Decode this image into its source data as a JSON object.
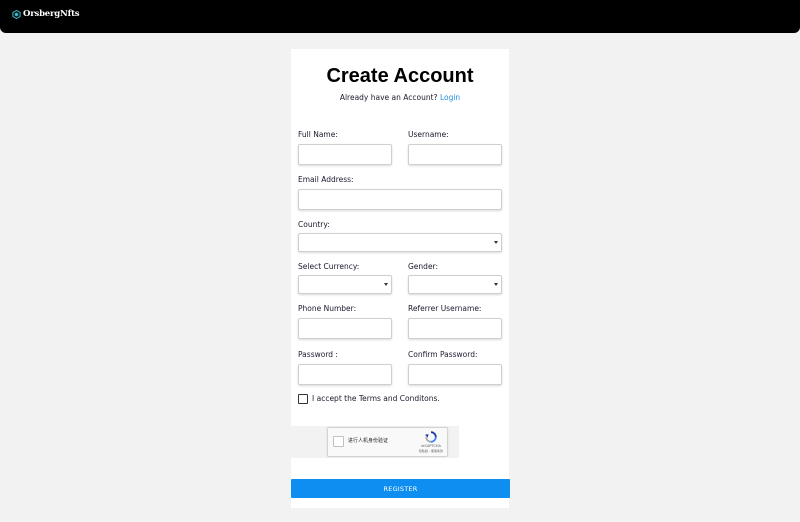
{
  "header": {
    "brand": "OrsbergNfts",
    "brand_icon": "hexagon-logo-icon",
    "accent_color": "#3ab7c9"
  },
  "form": {
    "title": "Create Account",
    "subtitle": "Already have an Account?",
    "login_link": "Login",
    "fields": {
      "full_name": {
        "label": "Full Name:",
        "value": ""
      },
      "username": {
        "label": "Username:",
        "value": ""
      },
      "email": {
        "label": "Email Address:",
        "value": ""
      },
      "country": {
        "label": "Country:",
        "value": ""
      },
      "currency": {
        "label": "Select Currency:",
        "value": ""
      },
      "gender": {
        "label": "Gender:",
        "value": ""
      },
      "phone": {
        "label": "Phone Number:",
        "value": ""
      },
      "referrer": {
        "label": "Referrer Username:",
        "value": ""
      },
      "password": {
        "label": "Password :",
        "value": ""
      },
      "confirm_password": {
        "label": "Confirm Password:",
        "value": ""
      }
    },
    "terms_label": "I accept the Terms and Conditons.",
    "terms_checked": false,
    "captcha": {
      "label": "进行人机身份验证",
      "brand": "reCAPTCHA",
      "links": "隐私权 - 使用条款",
      "icon": "recaptcha-logo-icon"
    },
    "register_label": "REGISTER",
    "register_color": "#0d8ef0"
  }
}
